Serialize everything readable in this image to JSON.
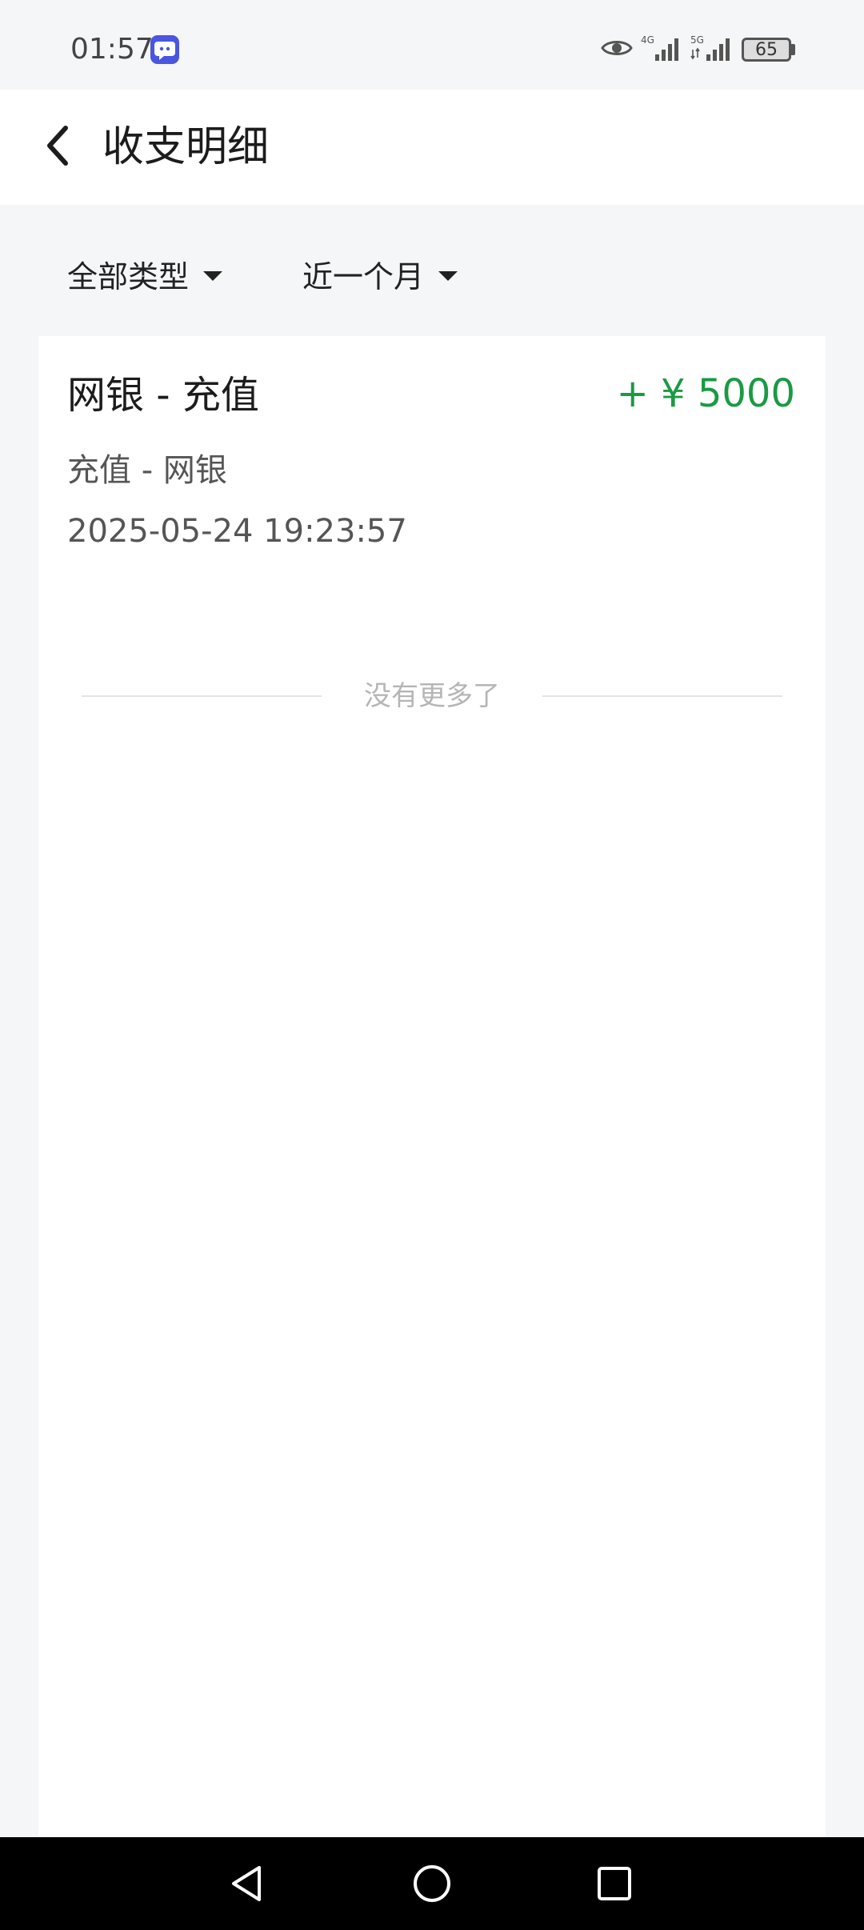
{
  "status_bar": {
    "time": "01:57",
    "app_icon": "chat-bubble-icon",
    "indicators": [
      "eye-icon",
      "signal-4g-icon",
      "signal-5g-icon"
    ],
    "network_1": "4G",
    "network_2": "5G",
    "battery_level": "65"
  },
  "header": {
    "back_icon": "chevron-left-icon",
    "title": "收支明细"
  },
  "filters": {
    "type_label": "全部类型",
    "period_label": "近一个月"
  },
  "transactions": [
    {
      "title": "网银 - 充值",
      "amount": "+ ¥ 5000",
      "description": "充值 - 网银",
      "timestamp": "2025-05-24 19:23:57"
    }
  ],
  "list_end_text": "没有更多了",
  "colors": {
    "income": "#1a9a44",
    "background": "#f5f6f8",
    "card": "#ffffff"
  }
}
